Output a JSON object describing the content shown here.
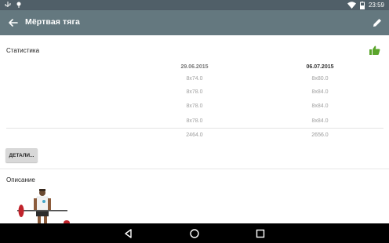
{
  "status_bar": {
    "time": "23:59",
    "icons": [
      "usb-icon",
      "notification-icon",
      "wifi-icon",
      "battery-icon"
    ]
  },
  "app_bar": {
    "title": "Мёртвая тяга",
    "back_icon": "arrow-back-icon",
    "edit_icon": "pencil-icon"
  },
  "stats": {
    "title": "Статистика",
    "thumb_icon": "thumbs-up-icon",
    "thumb_color": "#5aa52b",
    "columns": [
      {
        "date": "29.06.2015",
        "sets": [
          "8x74.0",
          "8x78.0",
          "8x78.0",
          "8x78.0"
        ],
        "total": "2464.0"
      },
      {
        "date": "06.07.2015",
        "sets": [
          "8x80.0",
          "8x84.0",
          "8x84.0",
          "8x84.0"
        ],
        "total": "2656.0"
      }
    ],
    "details_button": "ДЕТАЛИ..."
  },
  "description": {
    "title": "Описание"
  },
  "nav_bar": {
    "back": "nav-back-icon",
    "home": "nav-home-icon",
    "recents": "nav-recents-icon"
  }
}
